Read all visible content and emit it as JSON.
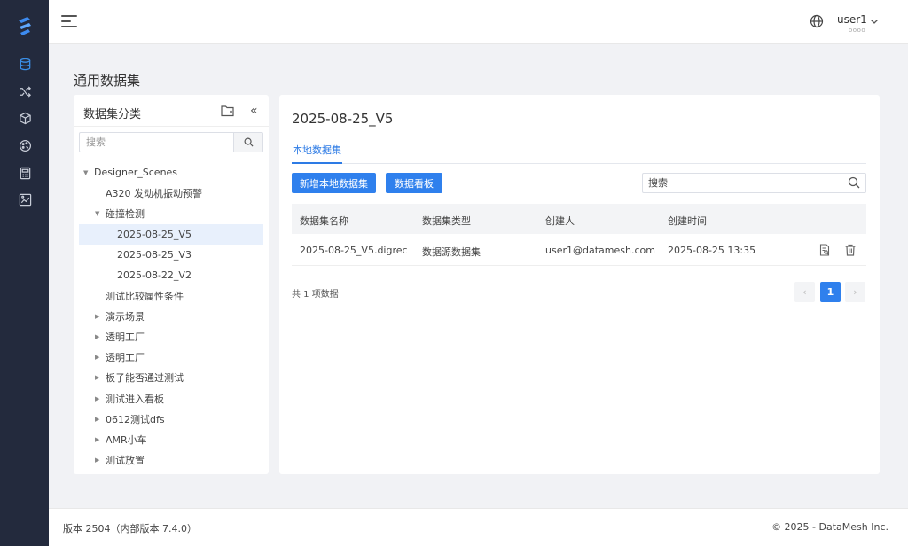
{
  "sidebar": {
    "logo": "datamesh-logo",
    "items": [
      {
        "icon": "database-icon",
        "active": true
      },
      {
        "icon": "shuffle-icon",
        "active": false
      },
      {
        "icon": "cube-icon",
        "active": false
      },
      {
        "icon": "palette-icon",
        "active": false
      },
      {
        "icon": "calculator-icon",
        "active": false
      },
      {
        "icon": "chart-image-icon",
        "active": false
      }
    ]
  },
  "header": {
    "user_name": "user1",
    "user_sub": "oooo"
  },
  "page": {
    "title": "通用数据集"
  },
  "left_panel": {
    "title": "数据集分类",
    "search_placeholder": "搜索",
    "tree": [
      {
        "label": "Designer_Scenes",
        "level": 0,
        "caret": "down"
      },
      {
        "label": "A320 发动机振动预警",
        "level": 1,
        "caret": ""
      },
      {
        "label": "碰撞检测",
        "level": 1,
        "caret": "down"
      },
      {
        "label": "2025-08-25_V5",
        "level": 2,
        "caret": "",
        "selected": true
      },
      {
        "label": "2025-08-25_V3",
        "level": 2,
        "caret": ""
      },
      {
        "label": "2025-08-22_V2",
        "level": 2,
        "caret": ""
      },
      {
        "label": "测试比较属性条件",
        "level": 1,
        "caret": ""
      },
      {
        "label": "演示场景",
        "level": 1,
        "caret": "right"
      },
      {
        "label": "透明工厂",
        "level": 1,
        "caret": "right"
      },
      {
        "label": "透明工厂",
        "level": 1,
        "caret": "right"
      },
      {
        "label": "板子能否通过测试",
        "level": 1,
        "caret": "right"
      },
      {
        "label": "测试进入看板",
        "level": 1,
        "caret": "right"
      },
      {
        "label": "0612测试dfs",
        "level": 1,
        "caret": "right"
      },
      {
        "label": "AMR小车",
        "level": 1,
        "caret": "right"
      },
      {
        "label": "测试放置",
        "level": 1,
        "caret": "right"
      }
    ]
  },
  "right_panel": {
    "title": "2025-08-25_V5",
    "tab_label": "本地数据集",
    "btn_add": "新增本地数据集",
    "btn_board": "数据看板",
    "search_placeholder": "搜索",
    "columns": [
      "数据集名称",
      "数据集类型",
      "创建人",
      "创建时间"
    ],
    "rows": [
      {
        "name": "2025-08-25_V5.digrec",
        "type": "数据源数据集",
        "creator": "user1@datamesh.com",
        "time": "2025-08-25 13:35"
      }
    ],
    "total_text": "共 1 项数据",
    "current_page": "1",
    "prev": "‹",
    "next": "›"
  },
  "footer": {
    "version": "版本 2504（内部版本 7.4.0）",
    "copyright": "© 2025 - DataMesh Inc."
  },
  "colors": {
    "primary": "#2f80ed",
    "sidebar_bg": "#232a3d",
    "active_icon": "#3a8ee6"
  }
}
